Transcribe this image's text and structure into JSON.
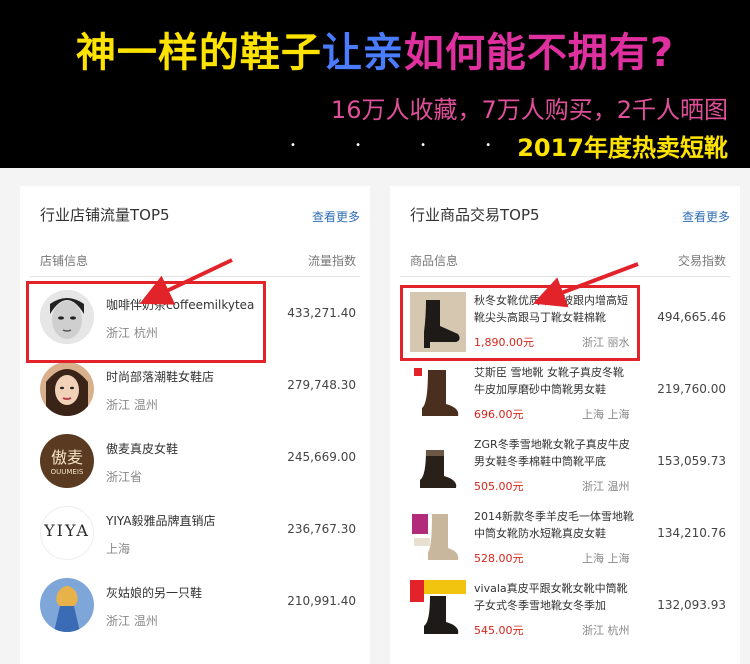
{
  "banner": {
    "headline_parts": [
      {
        "text": "神一样的鞋子",
        "color": "#ffe300"
      },
      {
        "text": "让亲",
        "color": "#4a7cff"
      },
      {
        "text": "如何能不拥有?",
        "color": "#e030a0"
      }
    ],
    "subline": "16万人收藏，7万人购买，2千人晒图",
    "year_line": "2017年度热卖短靴",
    "colors": {
      "background": "#000000",
      "subline": "#e0509a",
      "year_line": "#ffe300"
    }
  },
  "left_panel": {
    "title": "行业店铺流量TOP5",
    "more_link": "查看更多",
    "col_info": "店铺信息",
    "col_metric": "流量指数",
    "rows": [
      {
        "name": "咖啡伴奶茶coffeemilkytea",
        "location": "浙江 杭州",
        "metric": "433,271.40",
        "avatar": "portrait-bw"
      },
      {
        "name": "时尚部落潮鞋女鞋店",
        "location": "浙江 温州",
        "metric": "279,748.30",
        "avatar": "portrait-color"
      },
      {
        "name": "傲麦真皮女鞋",
        "location": "浙江省",
        "metric": "245,669.00",
        "avatar": "oumeis-logo",
        "logo_text": "傲麦",
        "logo_sub": "OUUMEIS"
      },
      {
        "name": "YIYA毅雅品牌直销店",
        "location": "上海",
        "metric": "236,767.30",
        "avatar": "yiya-logo",
        "logo_text": "YIYA"
      },
      {
        "name": "灰姑娘的另一只鞋",
        "location": "浙江 温州",
        "metric": "210,991.40",
        "avatar": "princess"
      }
    ]
  },
  "right_panel": {
    "title": "行业商品交易TOP5",
    "more_link": "查看更多",
    "col_info": "商品信息",
    "col_metric": "交易指数",
    "rows": [
      {
        "name": "秋冬女靴优质牛皮坡跟内增高短靴尖头高跟马丁靴女鞋棉靴",
        "price": "1,890.00元",
        "location": "浙江 丽水",
        "metric": "494,665.46"
      },
      {
        "name": "艾斯臣 雪地靴 女靴子真皮冬靴牛皮加厚磨砂中筒靴男女鞋",
        "price": "696.00元",
        "location": "上海 上海",
        "metric": "219,760.00"
      },
      {
        "name": "ZGR冬季雪地靴女靴子真皮牛皮男女鞋冬季棉鞋中筒靴平底",
        "price": "505.00元",
        "location": "浙江 温州",
        "metric": "153,059.73"
      },
      {
        "name": "2014新款冬季羊皮毛一体雪地靴中筒女靴防水短靴真皮女鞋",
        "price": "528.00元",
        "location": "上海 上海",
        "metric": "134,210.76"
      },
      {
        "name": "vivala真皮平跟女靴女靴中筒靴子女式冬季雪地靴女冬季加",
        "price": "545.00元",
        "location": "浙江 杭州",
        "metric": "132,093.93"
      }
    ]
  }
}
